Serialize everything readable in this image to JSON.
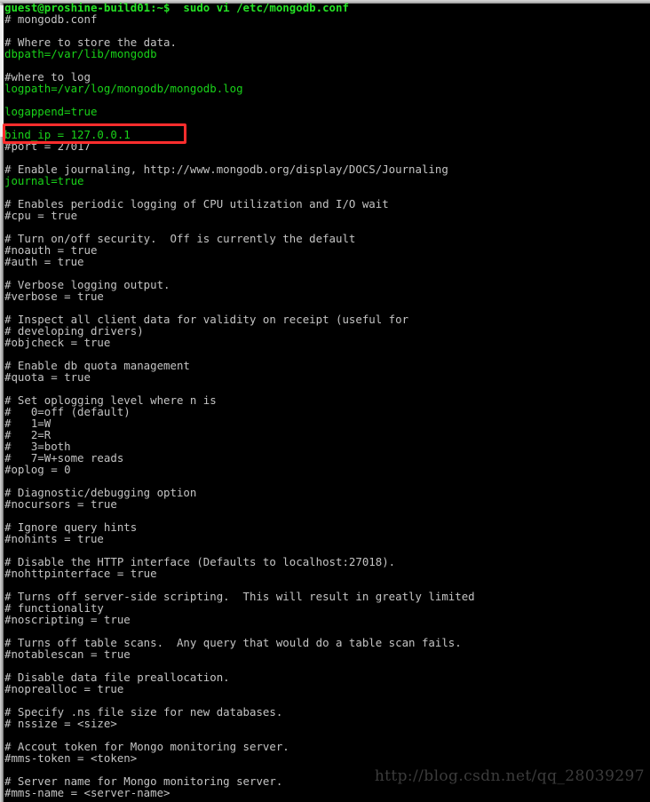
{
  "window": {
    "title": "guest@proshine-build01: ~",
    "shell_prompt": "guest@proshine-build01:~$",
    "command": "sudo vi /etc/mongodb.conf"
  },
  "colors": {
    "background": "#000000",
    "comment_text": "#c4c4c4",
    "config_value_text": "#19d219",
    "prompt_text": "#25e325",
    "highlight_border": "#ff2d2d",
    "watermark_text": "#3c3c3c",
    "chrome": "#bdbdbd"
  },
  "highlight": {
    "target_line_index": 10,
    "target_text": "bind_ip = 127.0.0.1",
    "shape": "rectangle",
    "color": "#ff2d2d"
  },
  "watermark": {
    "text": "http://blog.csdn.net/qq_28039297"
  },
  "terminal": {
    "lines": [
      {
        "text": "guest@proshine-build01:~$  sudo vi /etc/mongodb.conf",
        "type": "prompt"
      },
      {
        "text": "# mongodb.conf",
        "type": "comment"
      },
      {
        "text": "",
        "type": "blank"
      },
      {
        "text": "# Where to store the data.",
        "type": "comment"
      },
      {
        "text": "dbpath=/var/lib/mongodb",
        "type": "value"
      },
      {
        "text": "",
        "type": "blank"
      },
      {
        "text": "#where to log",
        "type": "comment"
      },
      {
        "text": "logpath=/var/log/mongodb/mongodb.log",
        "type": "value"
      },
      {
        "text": "",
        "type": "blank"
      },
      {
        "text": "logappend=true",
        "type": "value"
      },
      {
        "text": "",
        "type": "blank"
      },
      {
        "text": "bind_ip = 127.0.0.1",
        "type": "value"
      },
      {
        "text": "#port = 27017",
        "type": "comment"
      },
      {
        "text": "",
        "type": "blank"
      },
      {
        "text": "# Enable journaling, http://www.mongodb.org/display/DOCS/Journaling",
        "type": "comment"
      },
      {
        "text": "journal=true",
        "type": "value"
      },
      {
        "text": "",
        "type": "blank"
      },
      {
        "text": "# Enables periodic logging of CPU utilization and I/O wait",
        "type": "comment"
      },
      {
        "text": "#cpu = true",
        "type": "comment"
      },
      {
        "text": "",
        "type": "blank"
      },
      {
        "text": "# Turn on/off security.  Off is currently the default",
        "type": "comment"
      },
      {
        "text": "#noauth = true",
        "type": "comment"
      },
      {
        "text": "#auth = true",
        "type": "comment"
      },
      {
        "text": "",
        "type": "blank"
      },
      {
        "text": "# Verbose logging output.",
        "type": "comment"
      },
      {
        "text": "#verbose = true",
        "type": "comment"
      },
      {
        "text": "",
        "type": "blank"
      },
      {
        "text": "# Inspect all client data for validity on receipt (useful for",
        "type": "comment"
      },
      {
        "text": "# developing drivers)",
        "type": "comment"
      },
      {
        "text": "#objcheck = true",
        "type": "comment"
      },
      {
        "text": "",
        "type": "blank"
      },
      {
        "text": "# Enable db quota management",
        "type": "comment"
      },
      {
        "text": "#quota = true",
        "type": "comment"
      },
      {
        "text": "",
        "type": "blank"
      },
      {
        "text": "# Set oplogging level where n is",
        "type": "comment"
      },
      {
        "text": "#   0=off (default)",
        "type": "comment"
      },
      {
        "text": "#   1=W",
        "type": "comment"
      },
      {
        "text": "#   2=R",
        "type": "comment"
      },
      {
        "text": "#   3=both",
        "type": "comment"
      },
      {
        "text": "#   7=W+some reads",
        "type": "comment"
      },
      {
        "text": "#oplog = 0",
        "type": "comment"
      },
      {
        "text": "",
        "type": "blank"
      },
      {
        "text": "# Diagnostic/debugging option",
        "type": "comment"
      },
      {
        "text": "#nocursors = true",
        "type": "comment"
      },
      {
        "text": "",
        "type": "blank"
      },
      {
        "text": "# Ignore query hints",
        "type": "comment"
      },
      {
        "text": "#nohints = true",
        "type": "comment"
      },
      {
        "text": "",
        "type": "blank"
      },
      {
        "text": "# Disable the HTTP interface (Defaults to localhost:27018).",
        "type": "comment"
      },
      {
        "text": "#nohttpinterface = true",
        "type": "comment"
      },
      {
        "text": "",
        "type": "blank"
      },
      {
        "text": "# Turns off server-side scripting.  This will result in greatly limited",
        "type": "comment"
      },
      {
        "text": "# functionality",
        "type": "comment"
      },
      {
        "text": "#noscripting = true",
        "type": "comment"
      },
      {
        "text": "",
        "type": "blank"
      },
      {
        "text": "# Turns off table scans.  Any query that would do a table scan fails.",
        "type": "comment"
      },
      {
        "text": "#notablescan = true",
        "type": "comment"
      },
      {
        "text": "",
        "type": "blank"
      },
      {
        "text": "# Disable data file preallocation.",
        "type": "comment"
      },
      {
        "text": "#noprealloc = true",
        "type": "comment"
      },
      {
        "text": "",
        "type": "blank"
      },
      {
        "text": "# Specify .ns file size for new databases.",
        "type": "comment"
      },
      {
        "text": "# nssize = <size>",
        "type": "comment"
      },
      {
        "text": "",
        "type": "blank"
      },
      {
        "text": "# Accout token for Mongo monitoring server.",
        "type": "comment"
      },
      {
        "text": "#mms-token = <token>",
        "type": "comment"
      },
      {
        "text": "",
        "type": "blank"
      },
      {
        "text": "# Server name for Mongo monitoring server.",
        "type": "comment"
      },
      {
        "text": "#mms-name = <server-name>",
        "type": "comment"
      }
    ]
  }
}
